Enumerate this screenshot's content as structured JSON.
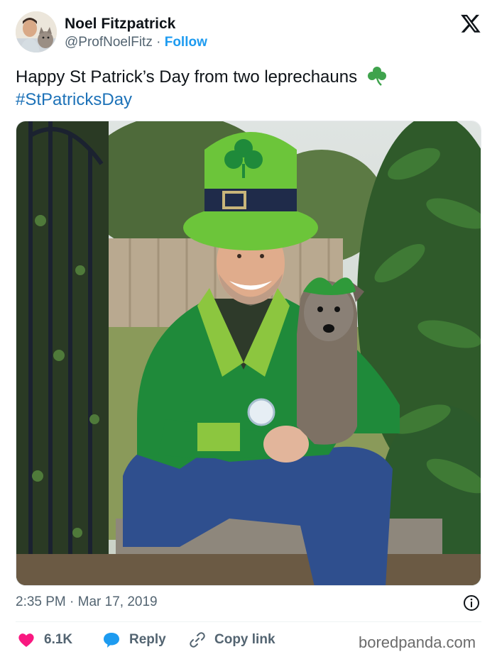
{
  "author": {
    "name": "Noel Fitzpatrick",
    "handle": "@ProfNoelFitz",
    "separator": "·",
    "follow_label": "Follow"
  },
  "tweet": {
    "text": "Happy St Patrick’s Day from two leprechauns",
    "hashtag": "#StPatricksDay",
    "emoji": "shamrock-icon"
  },
  "timestamp": {
    "time": "2:35 PM",
    "separator": "·",
    "date": "Mar 17, 2019"
  },
  "actions": {
    "like_count": "6.1K",
    "reply_label": "Reply",
    "copy_label": "Copy link"
  },
  "watermark": "boredpanda.com",
  "colors": {
    "accent": "#1d9bf0",
    "like": "#f91880",
    "text": "#0f1419",
    "muted": "#536471"
  }
}
